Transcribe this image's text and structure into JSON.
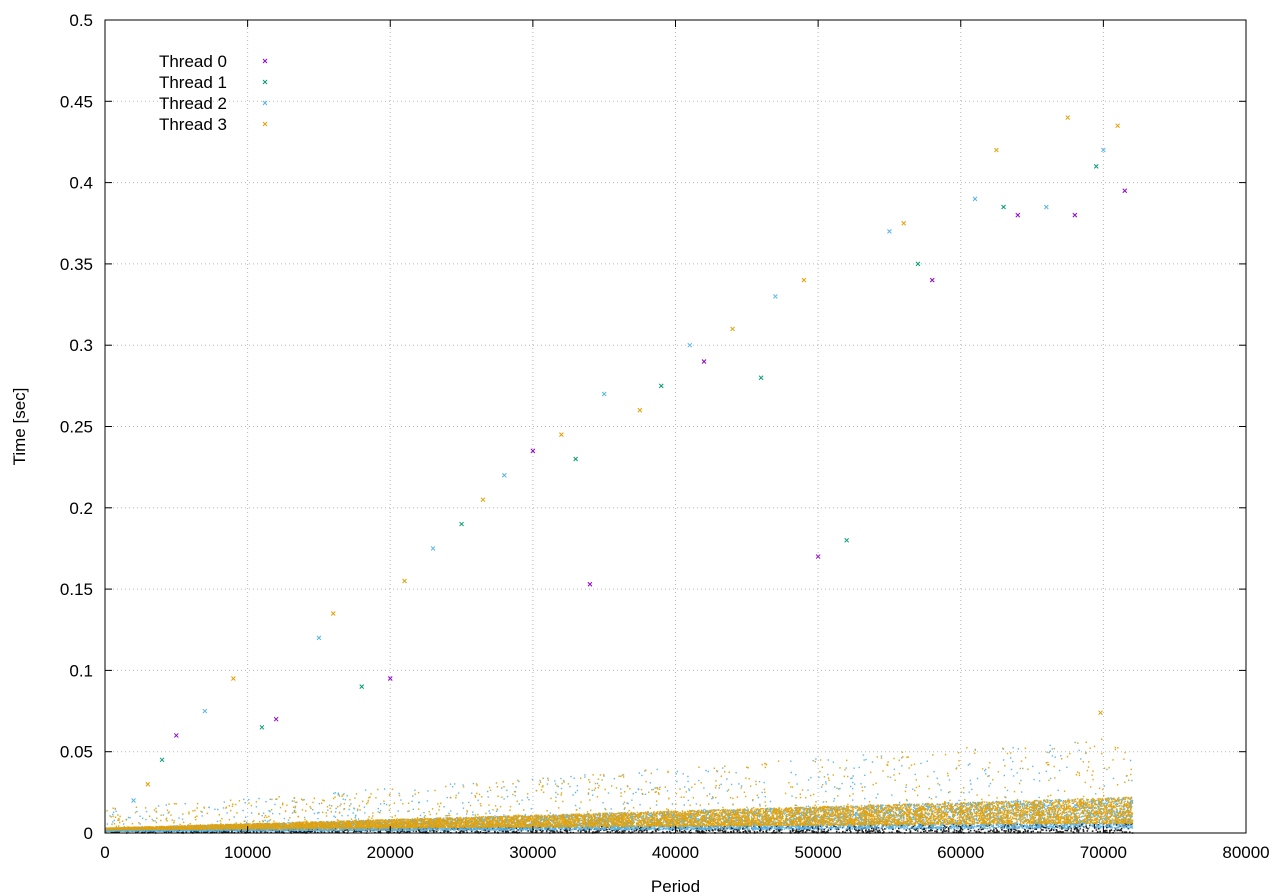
{
  "chart_data": {
    "type": "scatter",
    "title": "",
    "xlabel": "Period",
    "ylabel": "Time [sec]",
    "xlim": [
      0,
      80000
    ],
    "ylim": [
      0,
      0.5
    ],
    "x_ticks": [
      0,
      10000,
      20000,
      30000,
      40000,
      50000,
      60000,
      70000,
      80000
    ],
    "x_tick_labels": [
      "0",
      "10000",
      "20000",
      "30000",
      "40000",
      "50000",
      "60000",
      "70000",
      "80000"
    ],
    "y_ticks": [
      0,
      0.05,
      0.1,
      0.15,
      0.2,
      0.25,
      0.3,
      0.35,
      0.4,
      0.45,
      0.5
    ],
    "y_tick_labels": [
      "0",
      "0.05",
      "0.1",
      "0.15",
      "0.2",
      "0.25",
      "0.3",
      "0.35",
      "0.4",
      "0.45",
      "0.5"
    ],
    "grid": true,
    "legend_position": "top-left",
    "marker": "x",
    "series": [
      {
        "name": "Thread 0",
        "color": "#9400d3",
        "points": [
          [
            5000,
            0.06
          ],
          [
            12000,
            0.07
          ],
          [
            20000,
            0.095
          ],
          [
            30000,
            0.235
          ],
          [
            34000,
            0.153
          ],
          [
            42000,
            0.29
          ],
          [
            50000,
            0.17
          ],
          [
            58000,
            0.34
          ],
          [
            64000,
            0.38
          ],
          [
            68000,
            0.38
          ],
          [
            71500,
            0.395
          ]
        ]
      },
      {
        "name": "Thread 1",
        "color": "#009e73",
        "points": [
          [
            4000,
            0.045
          ],
          [
            11000,
            0.065
          ],
          [
            18000,
            0.09
          ],
          [
            25000,
            0.19
          ],
          [
            33000,
            0.23
          ],
          [
            39000,
            0.275
          ],
          [
            46000,
            0.28
          ],
          [
            52000,
            0.18
          ],
          [
            57000,
            0.35
          ],
          [
            63000,
            0.385
          ],
          [
            69500,
            0.41
          ]
        ]
      },
      {
        "name": "Thread 2",
        "color": "#56b4e9",
        "points": [
          [
            2000,
            0.02
          ],
          [
            7000,
            0.075
          ],
          [
            15000,
            0.12
          ],
          [
            23000,
            0.175
          ],
          [
            28000,
            0.22
          ],
          [
            35000,
            0.27
          ],
          [
            41000,
            0.3
          ],
          [
            47000,
            0.33
          ],
          [
            55000,
            0.37
          ],
          [
            61000,
            0.39
          ],
          [
            66000,
            0.385
          ],
          [
            70000,
            0.42
          ]
        ]
      },
      {
        "name": "Thread 3",
        "color": "#e69f00",
        "points": [
          [
            3000,
            0.03
          ],
          [
            9000,
            0.095
          ],
          [
            16000,
            0.135
          ],
          [
            21000,
            0.155
          ],
          [
            26500,
            0.205
          ],
          [
            32000,
            0.245
          ],
          [
            37500,
            0.26
          ],
          [
            44000,
            0.31
          ],
          [
            49000,
            0.34
          ],
          [
            56000,
            0.375
          ],
          [
            62500,
            0.42
          ],
          [
            67500,
            0.44
          ],
          [
            71000,
            0.435
          ],
          [
            69800,
            0.074
          ]
        ]
      }
    ],
    "dense_band": {
      "x_range": [
        0,
        72000
      ],
      "lower": {
        "start": 0.0,
        "end": 0.004,
        "color": "#1f1f1f"
      },
      "band": {
        "start": 0.003,
        "end": 0.022,
        "colors": [
          "#56b4e9",
          "#e69f00"
        ]
      },
      "spikes_max": {
        "start": 0.015,
        "end": 0.06
      }
    }
  }
}
